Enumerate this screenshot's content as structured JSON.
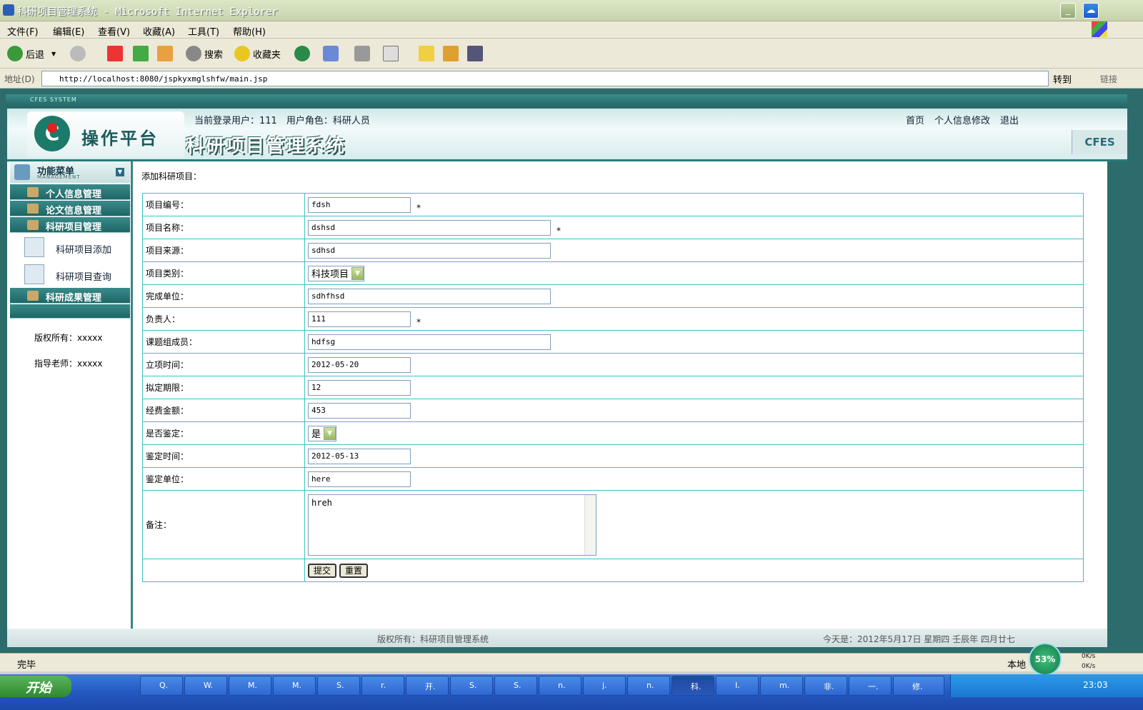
{
  "window": {
    "title": "科研项目管理系统 - Microsoft Internet Explorer"
  },
  "menu": [
    "文件(F)",
    "编辑(E)",
    "查看(V)",
    "收藏(A)",
    "工具(T)",
    "帮助(H)"
  ],
  "toolbar": {
    "back": "后退",
    "search": "搜索",
    "favorites": "收藏夹"
  },
  "address": {
    "label": "地址(D)",
    "url": "http://localhost:8080/jspkyxmglshfw/main.jsp",
    "go": "转到",
    "links": "链接"
  },
  "app": {
    "bar_title": "CFES SYSTEM",
    "logo_text": "操作平台",
    "system_name": "科研项目管理系统",
    "user_info": "当前登录用户：111　用户角色：科研人员",
    "links": {
      "home": "首页",
      "profile": "个人信息修改",
      "logout": "退出"
    },
    "brand": "CFES"
  },
  "sidebar": {
    "title": "功能菜单",
    "subtitle": "MANAGEMENT",
    "sections": [
      "个人信息管理",
      "论文信息管理",
      "科研项目管理"
    ],
    "items": [
      "科研项目添加",
      "科研项目查询"
    ],
    "section_after": "科研成果管理",
    "copyright": "版权所有：xxxxx",
    "teacher": "指导老师：xxxxx"
  },
  "form": {
    "title": "添加科研项目：",
    "fields": [
      {
        "label": "项目编号：",
        "value": "fdsh"
      },
      {
        "label": "项目名称：",
        "value": "dshsd"
      },
      {
        "label": "项目来源：",
        "value": "sdhsd"
      },
      {
        "label": "项目类别：",
        "value": "科技项目"
      },
      {
        "label": "完成单位：",
        "value": "sdhfhsd"
      },
      {
        "label": "负责人：",
        "value": "111"
      },
      {
        "label": "课题组成员：",
        "value": "hdfsg"
      },
      {
        "label": "立项时间：",
        "value": "2012-05-20"
      },
      {
        "label": "拟定期限：",
        "value": "12"
      },
      {
        "label": "经费金额：",
        "value": "453"
      },
      {
        "label": "是否鉴定：",
        "value": "是"
      },
      {
        "label": "鉴定时间：",
        "value": "2012-05-13"
      },
      {
        "label": "鉴定单位：",
        "value": "here"
      },
      {
        "label": "备注：",
        "value": "hreh"
      }
    ],
    "required_mark": "*",
    "submit": "提交",
    "reset": "重置"
  },
  "footer": {
    "copyright": "版权所有：科研项目管理系统",
    "date": "今天是：2012年5月17日 星期四 壬辰年 四月廿七"
  },
  "status": {
    "done": "完毕",
    "zone": "本地",
    "cpu": "53%",
    "up": "0K/s",
    "down": "0K/s"
  },
  "taskbar": {
    "start": "开始",
    "clock": "23:03",
    "buttons": [
      "Q.",
      "W.",
      "M.",
      "M.",
      "S.",
      "r.",
      "开.",
      "S.",
      "S.",
      "n.",
      "j.",
      "n.",
      "科.",
      "I.",
      "m.",
      "非.",
      "一.",
      "修."
    ]
  }
}
